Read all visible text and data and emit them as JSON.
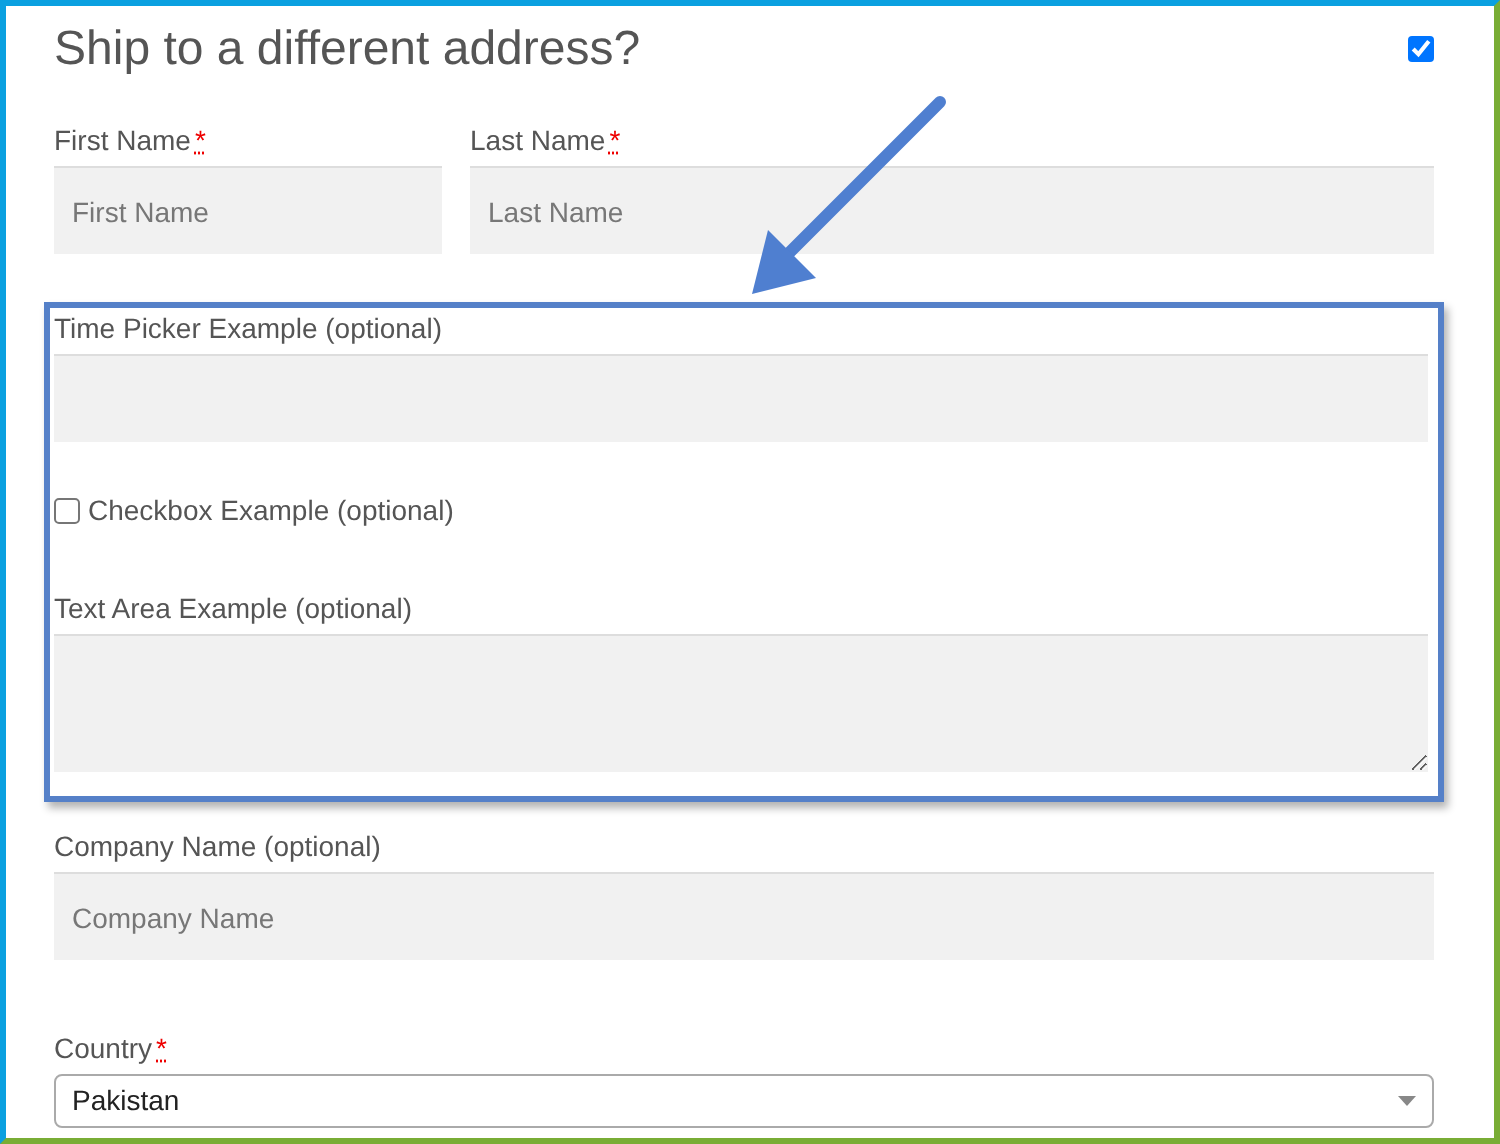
{
  "heading": "Ship to a different address?",
  "ship_checkbox": {
    "checked": true
  },
  "name_fields": [
    {
      "label": "First Name",
      "required_mark": "*",
      "placeholder": "First Name"
    },
    {
      "label": "Last Name",
      "required_mark": "*",
      "placeholder": "Last Name"
    }
  ],
  "highlight_fields": [
    {
      "kind": "input",
      "label": "Time Picker Example (optional)"
    },
    {
      "kind": "checkbox",
      "label": "Checkbox Example (optional)",
      "checked": false
    },
    {
      "kind": "textarea",
      "label": "Text Area Example (optional)"
    }
  ],
  "fields": [
    {
      "kind": "input",
      "label": "Company Name (optional)",
      "placeholder": "Company Name"
    },
    {
      "kind": "select",
      "label": "Country",
      "required_mark": "*",
      "value": "Pakistan"
    }
  ]
}
